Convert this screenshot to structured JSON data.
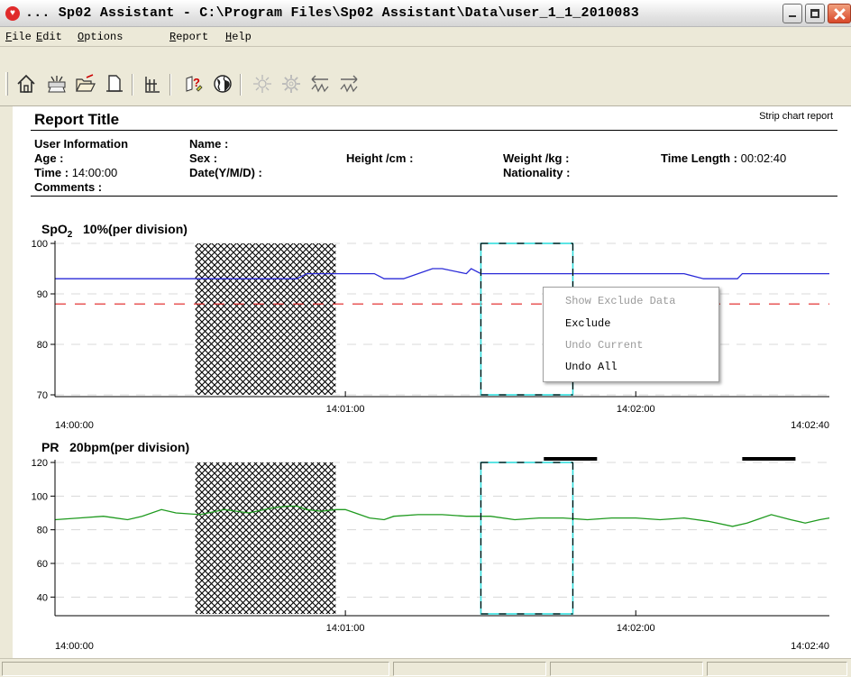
{
  "window": {
    "title": "... Sp02 Assistant  -  C:\\Program Files\\Sp02 Assistant\\Data\\user_1_1_2010083"
  },
  "menu": {
    "items": [
      {
        "label": "File"
      },
      {
        "label": "Edit"
      },
      {
        "label": "Options"
      },
      {
        "label": "Report"
      },
      {
        "label": "Help"
      }
    ]
  },
  "toolbar": {
    "icons": [
      "home-icon",
      "print-setup-icon",
      "open-folder-icon",
      "print-preview-icon",
      "grid-icon",
      "help-icon",
      "globe-icon",
      "sun-icon",
      "gear-icon",
      "arrow-left-icon",
      "arrow-right-icon"
    ]
  },
  "report": {
    "title": "Report Title",
    "subtitle": "Strip chart report",
    "user_information": "User Information",
    "name_label": "Name :",
    "age_label": "Age :",
    "sex_label": "Sex :",
    "height_label": "Height /cm :",
    "weight_label": "Weight /kg :",
    "time_length_label": "Time Length :",
    "time_length_value": "00:02:40",
    "time_label": "Time :",
    "time_value": "14:00:00",
    "date_label": "Date(Y/M/D) :",
    "nationality_label": "Nationality :",
    "comments_label": "Comments :"
  },
  "spo2_chart": {
    "label_prefix": "SpO",
    "label_sub": "2",
    "label_suffix": "10%(per division)",
    "y_ticks": [
      "100",
      "90",
      "80",
      "70"
    ],
    "x_ticks": [
      "14:00:00",
      "14:01:00",
      "14:02:00",
      "14:02:40"
    ]
  },
  "pr_chart": {
    "label": "PR",
    "label_suffix": "20bpm(per division)",
    "y_ticks": [
      "120",
      "100",
      "80",
      "60",
      "40"
    ],
    "x_ticks": [
      "14:00:00",
      "14:01:00",
      "14:02:00",
      "14:02:40"
    ]
  },
  "chart_data": [
    {
      "type": "line",
      "ylim": [
        70,
        100
      ],
      "x_range_seconds": [
        0,
        160
      ],
      "threshold": 88,
      "excluded_region_seconds": [
        29,
        58
      ],
      "selected_region_seconds": [
        88,
        107
      ],
      "series": [
        {
          "color": "#2a2ad8",
          "x": [
            0,
            30,
            50,
            52,
            66,
            68,
            72,
            78,
            80,
            85,
            86,
            88,
            89,
            93,
            100,
            110,
            119,
            120,
            130,
            134,
            141,
            142,
            148,
            150,
            160
          ],
          "values": [
            93,
            93,
            93,
            94,
            94,
            93,
            93,
            95,
            95,
            94,
            95,
            94,
            94,
            94,
            94,
            94,
            94,
            94,
            94,
            93,
            93,
            94,
            94,
            94,
            94
          ]
        }
      ]
    },
    {
      "type": "line",
      "ylim": [
        30,
        120
      ],
      "x_range_seconds": [
        0,
        160
      ],
      "excluded_region_seconds": [
        29,
        58
      ],
      "selected_region_seconds": [
        88,
        107
      ],
      "series": [
        {
          "color": "#1f9a1f",
          "x": [
            0,
            5,
            10,
            15,
            18,
            22,
            25,
            30,
            35,
            40,
            45,
            48,
            50,
            52,
            55,
            58,
            60,
            62,
            65,
            68,
            70,
            75,
            80,
            85,
            90,
            95,
            100,
            105,
            110,
            115,
            120,
            125,
            130,
            135,
            140,
            143,
            145,
            148,
            152,
            155,
            158,
            160
          ],
          "values": [
            86,
            87,
            88,
            86,
            88,
            92,
            90,
            89,
            92,
            90,
            93,
            94,
            94,
            92,
            91,
            92,
            92,
            90,
            87,
            86,
            88,
            89,
            89,
            88,
            88,
            86,
            87,
            87,
            86,
            87,
            87,
            86,
            87,
            85,
            82,
            84,
            86,
            89,
            86,
            84,
            86,
            87
          ]
        }
      ]
    }
  ],
  "context_menu": {
    "items": [
      {
        "label": "Show Exclude Data",
        "enabled": false
      },
      {
        "label": "Exclude",
        "enabled": true
      },
      {
        "label": "Undo Current",
        "enabled": false
      },
      {
        "label": "Undo All",
        "enabled": true
      }
    ]
  }
}
